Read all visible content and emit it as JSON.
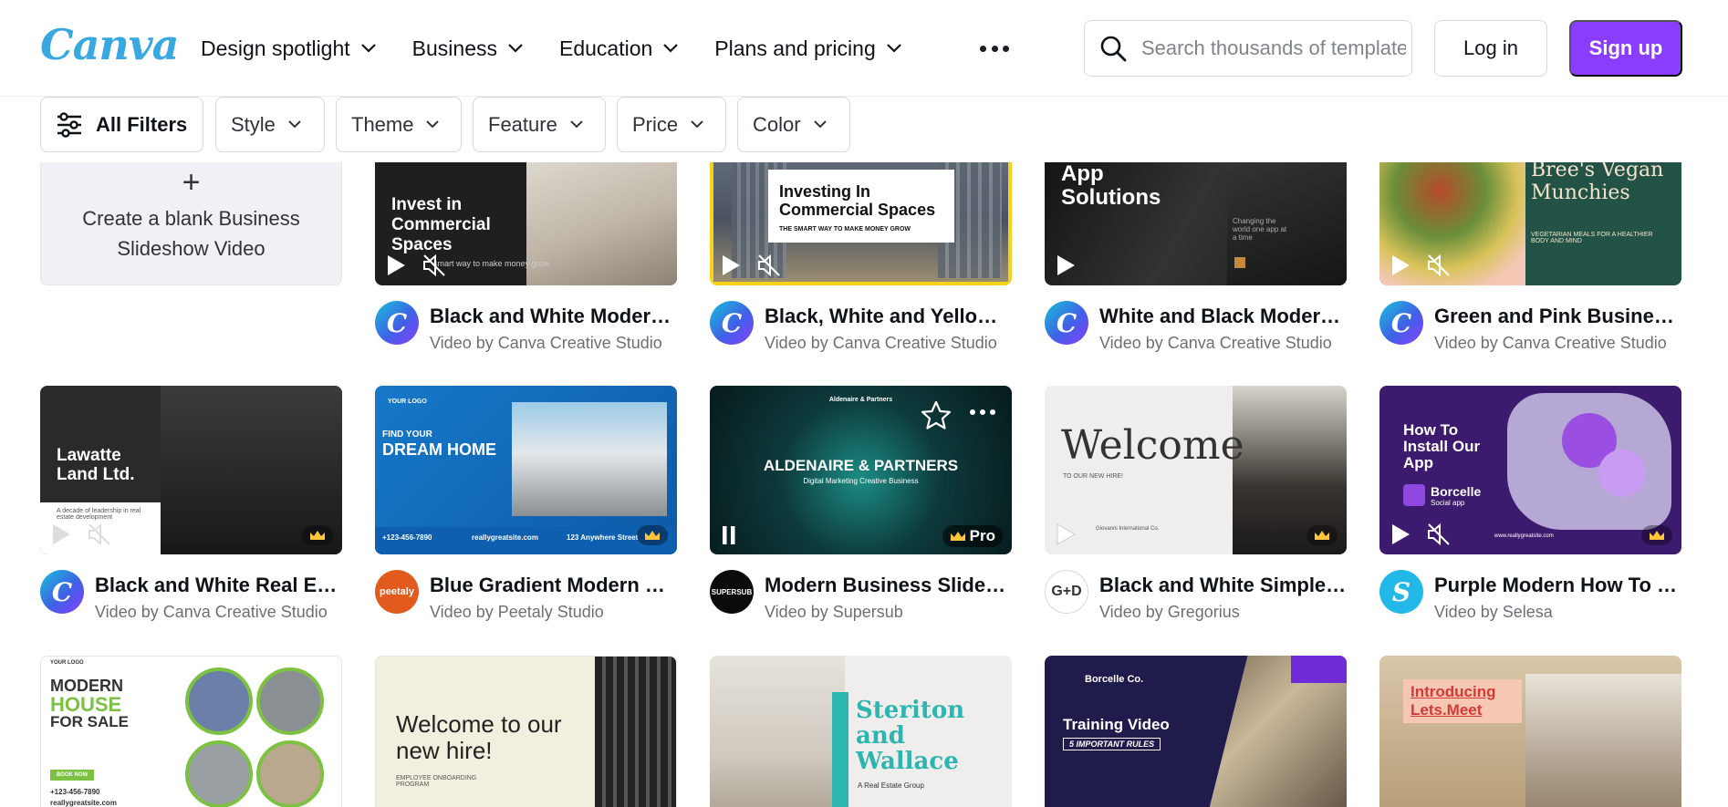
{
  "header": {
    "logo": "Canva",
    "nav": [
      {
        "label": "Design spotlight"
      },
      {
        "label": "Business"
      },
      {
        "label": "Education"
      },
      {
        "label": "Plans and pricing"
      }
    ],
    "search_placeholder": "Search thousands of templates",
    "login_label": "Log in",
    "signup_label": "Sign up"
  },
  "filters": {
    "all": "All Filters",
    "style": "Style",
    "theme": "Theme",
    "feature": "Feature",
    "price": "Price",
    "color": "Color"
  },
  "blank_card": {
    "plus": "+",
    "label": "Create a blank Business Slideshow Video"
  },
  "thumb_text": {
    "t1": "Invest in Commercial Spaces",
    "t1_small": "smart way to make money grow",
    "t2": "Investing In Commercial Spaces",
    "t2_small": "THE SMART WAY TO MAKE MONEY GROW",
    "t3": "App Solutions",
    "t3_small": "Changing the world one app at a time",
    "t4": "Bree's Vegan Munchies",
    "t4_small": "VEGETARIAN MEALS FOR A HEALTHIER BODY AND MIND",
    "t5": "Lawatte Land Ltd.",
    "t5_small": "A decade of leadership in real estate development",
    "t6_logo": "YOUR LOGO",
    "t6a": "FIND YOUR",
    "t6b": "DREAM HOME",
    "t6_phone": "+123-456-7890",
    "t6_site": "reallygreatsite.com",
    "t6_addr": "123 Anywhere Street",
    "t7_top": "Aldenaire & Partners",
    "t7": "ALDENAIRE & PARTNERS",
    "t7_small": "Digital Marketing Creative Business",
    "t7_pro": "Pro",
    "t8": "Welcome",
    "t8_small": "TO OUR NEW HIRE!",
    "t8_brand": "Giovanni International Co.",
    "t9": "How To Install Our App",
    "t9_brand": "Borcelle",
    "t9_sub": "Social app",
    "t9_site": "www.reallygreatsite.com",
    "t10_logo": "YOUR LOGO",
    "t10a": "MODERN",
    "t10b": "HOUSE",
    "t10c": "FOR SALE",
    "t10_book": "BOOK NOW",
    "t10_phone": "+123-456-7890",
    "t10_site": "reallygreatsite.com",
    "t11": "Welcome to our new hire!",
    "t11_small": "EMPLOYEE ONBOARDING PROGRAM",
    "t12": "Steriton and Wallace",
    "t12_small": "A Real Estate Group",
    "t13_brand": "Borcelle Co.",
    "t13": "Training Video",
    "t13_small": "5 IMPORTANT RULES",
    "t14": "Introducing Lets.Meet"
  },
  "cards": [
    {
      "title": "Black and White Modern Business Slideshow",
      "by": "Video by Canva Creative Studio"
    },
    {
      "title": "Black, White and Yellow Business Slideshow",
      "by": "Video by Canva Creative Studio"
    },
    {
      "title": "White and Black Modern App Video",
      "by": "Video by Canva Creative Studio"
    },
    {
      "title": "Green and Pink Business Video",
      "by": "Video by Canva Creative Studio"
    },
    {
      "title": "Black and White Real Estate Video",
      "by": "Video by Canva Creative Studio"
    },
    {
      "title": "Blue Gradient Modern Home Video",
      "by": "Video by Peetaly Studio"
    },
    {
      "title": "Modern Business Slideshow Video",
      "by": "Video by Supersub"
    },
    {
      "title": "Black and White Simple Welcome Video",
      "by": "Video by Gregorius"
    },
    {
      "title": "Purple Modern How To Install Video",
      "by": "Video by Selesa"
    }
  ],
  "avatars": {
    "peetaly": "peetaly",
    "supersub": "SUPERSUB",
    "gregorius": "G+D"
  },
  "colors": {
    "accent": "#8b3dff",
    "logo": "#3aa8e0"
  }
}
